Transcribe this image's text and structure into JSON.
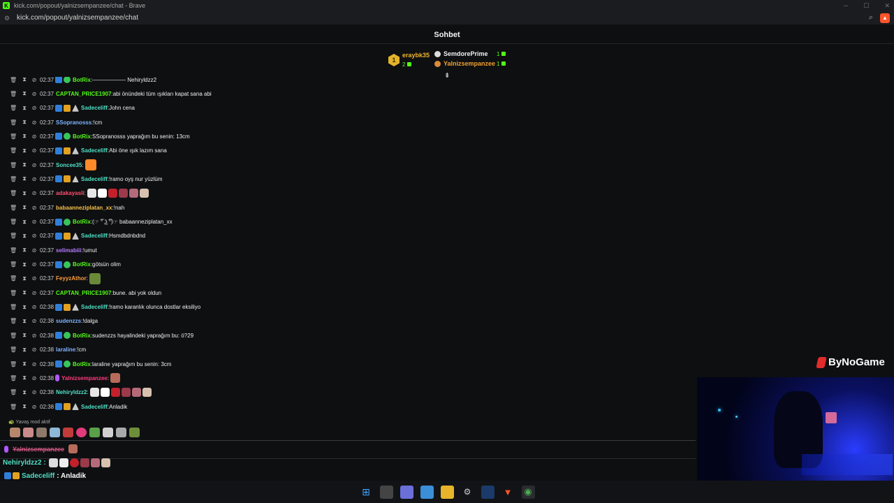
{
  "browser": {
    "window_title": "kick.com/popout/yalnizsempanzee/chat - Brave",
    "url": "kick.com/popout/yalnizsempanzee/chat"
  },
  "chat": {
    "heading": "Sohbet"
  },
  "leaderboard": {
    "first": {
      "rank": "1",
      "user": "eraybk35",
      "count": "2"
    },
    "others": [
      {
        "user": "SemdorePrime",
        "count": "1"
      },
      {
        "user": "Yalnizsempanzee",
        "count": "1"
      }
    ]
  },
  "messages": [
    {
      "time": "02:37",
      "user": "BotRix",
      "text": "—————— Nehiryldzz2",
      "color": "#53fc18"
    },
    {
      "time": "02:37",
      "user": "CAPTAN_PRICE1907",
      "text": "abi önündeki tüm ışıkları kapat sana abi",
      "color": "#53fc18"
    },
    {
      "time": "02:37",
      "user": "Sadeceliff",
      "text": "John cena",
      "color": "#4fe0c4"
    },
    {
      "time": "02:37",
      "user": "SSopranosss",
      "text": "!cm",
      "color": "#7fb5ff"
    },
    {
      "time": "02:37",
      "user": "BotRix",
      "text": "SSopranosss yaprağım bu senin: 13cm",
      "color": "#53fc18"
    },
    {
      "time": "02:37",
      "user": "Sadeceliff",
      "text": "Abi öne ışık lazım sana",
      "color": "#4fe0c4"
    },
    {
      "time": "02:37",
      "user": "Soncee35",
      "text": "",
      "color": "#4fe0c4"
    },
    {
      "time": "02:37",
      "user": "Sadeceliff",
      "text": "!ramo oyş nur yüzlüm",
      "color": "#4fe0c4"
    },
    {
      "time": "02:37",
      "user": "adakayasli",
      "text": "",
      "color": "#ff4f6d"
    },
    {
      "time": "02:37",
      "user": "babaanneziplatan_xx",
      "text": "!nah",
      "color": "#f7c24a"
    },
    {
      "time": "02:37",
      "user": "BotRix",
      "text": "(☞ ͡° ͜ʖ ͡°)☞ babaanneziplatan_xx",
      "color": "#53fc18"
    },
    {
      "time": "02:37",
      "user": "Sadeceliff",
      "text": "Hsmdbdnbdnd",
      "color": "#4fe0c4"
    },
    {
      "time": "02:37",
      "user": "selimabiii",
      "text": "!umut",
      "color": "#b57cff"
    },
    {
      "time": "02:37",
      "user": "BotRix",
      "text": "götsün olim",
      "color": "#53fc18"
    },
    {
      "time": "02:37",
      "user": "FeyyzAthor",
      "text": "",
      "color": "#ff9f3a"
    },
    {
      "time": "02:37",
      "user": "CAPTAN_PRICE1907",
      "text": "bune. abi yok oldun",
      "color": "#53fc18"
    },
    {
      "time": "02:38",
      "user": "Sadeceliff",
      "text": "!ramo karanlık olunca dostlar eksiliyo",
      "color": "#4fe0c4"
    },
    {
      "time": "02:38",
      "user": "sudenzzs",
      "text": "!dalga",
      "color": "#7fb5ff"
    },
    {
      "time": "02:38",
      "user": "BotRix",
      "text": "sudenzzs hayalindeki yaprağım bu: ö?29",
      "color": "#53fc18"
    },
    {
      "time": "02:38",
      "user": "laraline",
      "text": "!cm",
      "color": "#7fb5ff"
    },
    {
      "time": "02:38",
      "user": "BotRix",
      "text": "laraline yaprağım bu senin: 3cm",
      "color": "#53fc18"
    },
    {
      "time": "02:38",
      "user": "Yalnizsempanzee",
      "text": "",
      "color": "#ff3b7a"
    },
    {
      "time": "02:38",
      "user": "Nehiryldzz2",
      "text": "",
      "color": "#4fe0c4"
    },
    {
      "time": "02:38",
      "user": "Sadeceliff",
      "text": "Anladik",
      "color": "#4fe0c4"
    }
  ],
  "slow_mode_text": "Yavaş mod aktif",
  "overlay": {
    "reply_user": "Yalnizsempanzee",
    "line1_user": "Nehiryldzz2 :",
    "line2_user": "Sadeceliff",
    "line2_text": ": Anladik",
    "brand": "ByNoGame"
  }
}
